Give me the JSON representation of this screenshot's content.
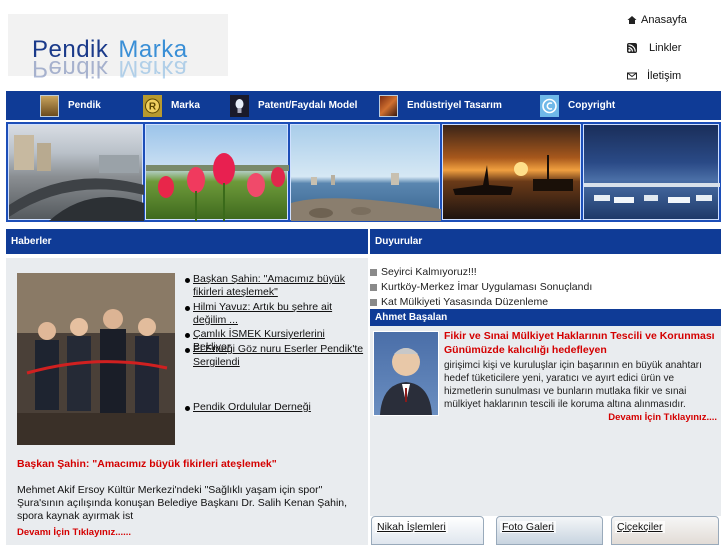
{
  "header": {
    "logo_word1": "Pendik",
    "logo_word2": "Marka",
    "links": [
      {
        "label": "Anasayfa",
        "icon": "home-icon"
      },
      {
        "label": "Linkler",
        "icon": "rss-icon"
      },
      {
        "label": "İletişim",
        "icon": "mail-icon"
      }
    ]
  },
  "nav": {
    "items": [
      {
        "label": "Pendik",
        "icon": "pendik-icon"
      },
      {
        "label": "Marka",
        "icon": "registered-mark-icon"
      },
      {
        "label": "Patent/Faydalı Model",
        "icon": "lightbulb-icon"
      },
      {
        "label": "Endüstriyel Tasarım",
        "icon": "design-icon"
      },
      {
        "label": "Copyright",
        "icon": "copyright-icon"
      }
    ]
  },
  "sections": {
    "haberler": "Haberler",
    "duyurular": "Duyurular",
    "ahmet": "Ahmet Başalan"
  },
  "news": {
    "links": [
      "Başkan Şahin: \"Amacımız büyük fikirleri ateşlemek\"",
      "Hilmi Yavuz: Artık bu şehre ait değilim ...",
      "Çamlık İSMEK Kursiyerlerini Bekliyor",
      "El Emeği Göz nuru Eserler Pendik'te Sergilendi",
      "Pendik Ordulular Derneği"
    ],
    "headline": "Başkan Şahin: \"Amacımız büyük fikirleri ateşlemek\"",
    "body": "Mehmet Akif Ersoy Kültür Merkezi'ndeki \"Sağlıklı yaşam için spor\" Şura'sının açılışında konuşan Belediye Başkanı Dr. Salih Kenan Şahin, spora kaynak ayırmak ist",
    "more": "Devamı İçin Tıklayınız......"
  },
  "duyurular": {
    "items": [
      "Seyirci Kalmıyoruz!!!",
      "Kurtköy-Merkez İmar Uygulaması Sonuçlandı",
      "Kat Mülkiyeti Yasasında Düzenleme"
    ]
  },
  "ahmet": {
    "title": "Fikir ve Sınai Mülkiyet Haklarının Tescili ve Korunması Günümüzde kalıcılığı hedefleyen",
    "body": "girişimci kişi ve kuruluşlar için başarının en büyük anahtarı hedef tüketicilere yeni, yaratıcı ve ayırt edici ürün ve hizmetlerin sunulması ve bunların mutlaka fikir ve sınai mülkiyet haklarının tescili ile koruma altına alınmasıdır.",
    "more": "Devamı İçin Tıklayınız...."
  },
  "tabs": [
    "Nikah İşlemleri",
    "Foto Galeri",
    "Çiçekçiler"
  ]
}
